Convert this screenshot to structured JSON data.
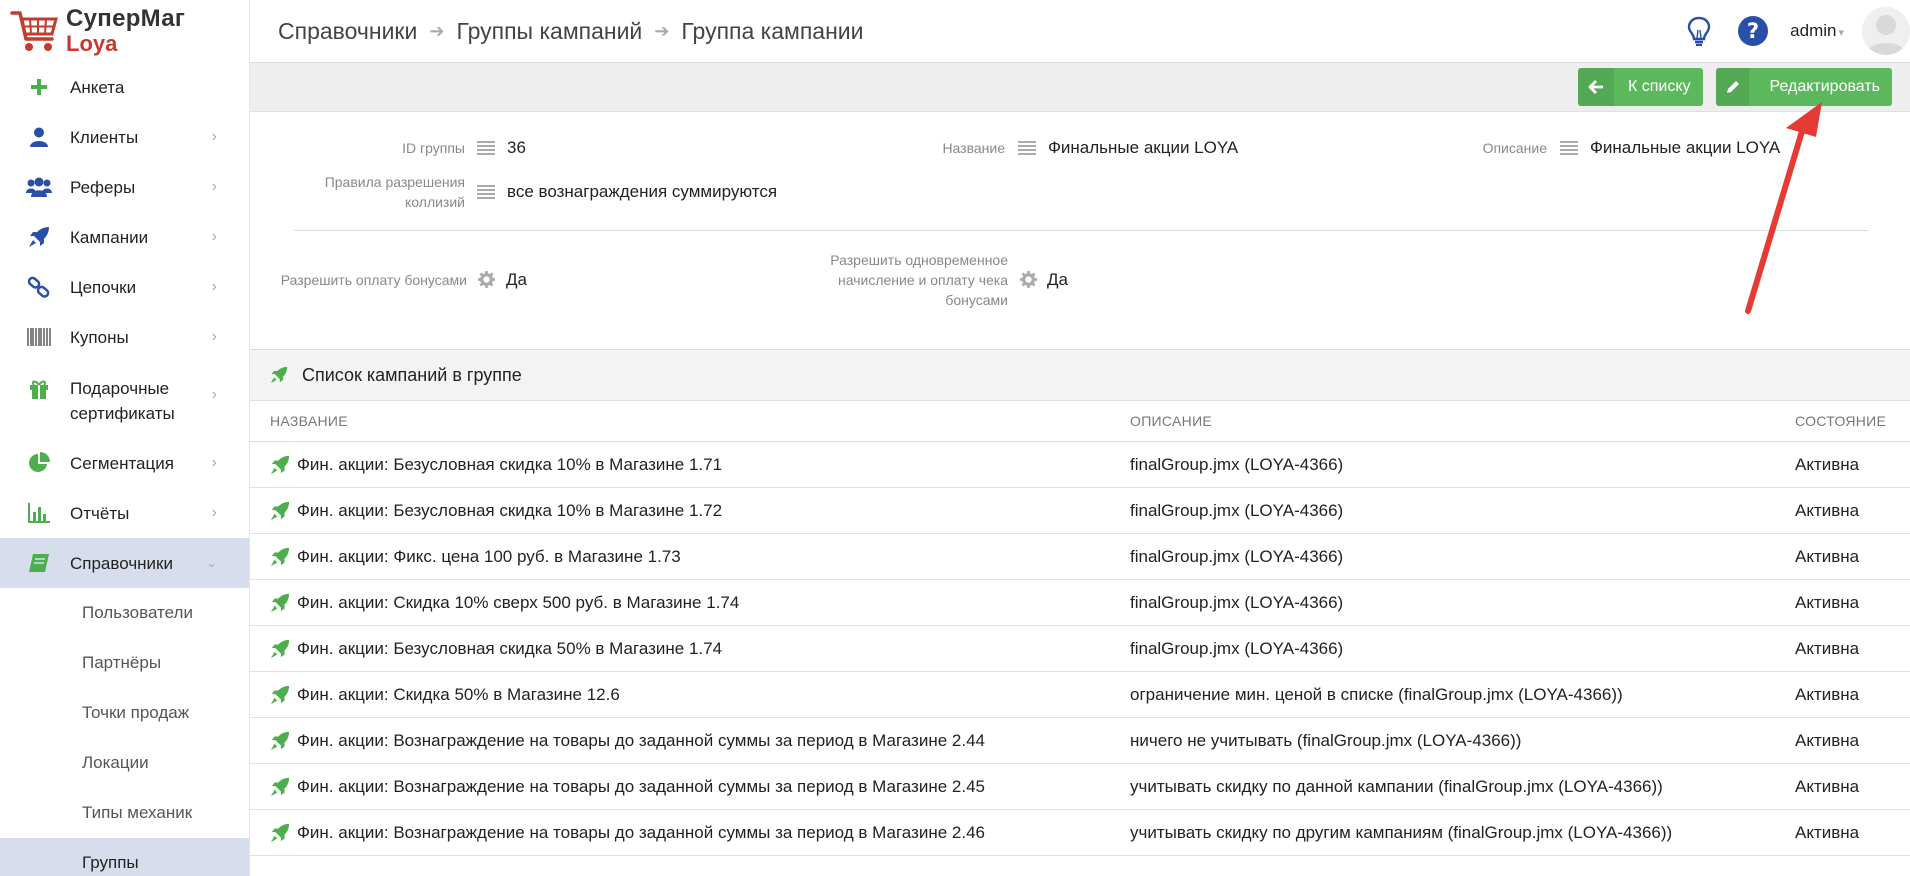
{
  "brand": {
    "line1": "СуперМаг",
    "line2": "Loya"
  },
  "sidebar": {
    "items": [
      {
        "label": "Анкета",
        "icon": "plus-icon"
      },
      {
        "label": "Клиенты",
        "icon": "user-icon"
      },
      {
        "label": "Реферы",
        "icon": "users-icon"
      },
      {
        "label": "Кампании",
        "icon": "rocket-icon"
      },
      {
        "label": "Цепочки",
        "icon": "link-icon"
      },
      {
        "label": "Купоны",
        "icon": "barcode-icon"
      },
      {
        "label": "Подарочные сертификаты",
        "icon": "gift-icon"
      },
      {
        "label": "Сегментация",
        "icon": "pie-chart-icon"
      },
      {
        "label": "Отчёты",
        "icon": "bar-chart-icon"
      },
      {
        "label": "Справочники",
        "icon": "book-icon"
      }
    ],
    "subitems": [
      "Пользователи",
      "Партнёры",
      "Точки продаж",
      "Локации",
      "Типы механик",
      "Группы"
    ]
  },
  "breadcrumb": [
    "Справочники",
    "Группы кампаний",
    "Группа кампании"
  ],
  "header": {
    "user": "admin"
  },
  "toolbar": {
    "back_label": "К списку",
    "edit_label": "Редактировать"
  },
  "details": {
    "id_label": "ID группы",
    "id_value": "36",
    "name_label": "Название",
    "name_value": "Финальные акции LOYA",
    "desc_label": "Описание",
    "desc_value": "Финальные акции LOYA",
    "rules_label_1": "Правила разрешения",
    "rules_label_2": "коллизий",
    "rules_value": "все вознаграждения суммируются",
    "bonus_label": "Разрешить оплату бонусами",
    "bonus_value": "Да",
    "simul_label_1": "Разрешить одновременное",
    "simul_label_2": "начисление и оплату чека",
    "simul_label_3": "бонусами",
    "simul_value": "Да"
  },
  "campaigns": {
    "title": "Список кампаний в группе",
    "columns": {
      "name": "НАЗВАНИЕ",
      "desc": "ОПИСАНИЕ",
      "state": "СОСТОЯНИЕ"
    },
    "rows": [
      {
        "name": "Фин. акции: Безусловная скидка 10% в Магазине 1.71",
        "desc": "finalGroup.jmx (LOYA-4366)",
        "state": "Активна"
      },
      {
        "name": "Фин. акции: Безусловная скидка 10% в Магазине 1.72",
        "desc": "finalGroup.jmx (LOYA-4366)",
        "state": "Активна"
      },
      {
        "name": "Фин. акции: Фикс. цена 100 руб. в Магазине 1.73",
        "desc": "finalGroup.jmx (LOYA-4366)",
        "state": "Активна"
      },
      {
        "name": "Фин. акции: Скидка 10% сверх 500 руб. в Магазине 1.74",
        "desc": "finalGroup.jmx (LOYA-4366)",
        "state": "Активна"
      },
      {
        "name": "Фин. акции: Безусловная скидка 50% в Магазине 1.74",
        "desc": "finalGroup.jmx (LOYA-4366)",
        "state": "Активна"
      },
      {
        "name": "Фин. акции: Скидка 50% в Магазине 12.6",
        "desc": "ограничение мин. ценой в списке (finalGroup.jmx (LOYA-4366))",
        "state": "Активна"
      },
      {
        "name": "Фин. акции: Вознаграждение на товары до заданной суммы за период в Магазине 2.44",
        "desc": "ничего не учитывать (finalGroup.jmx (LOYA-4366))",
        "state": "Активна"
      },
      {
        "name": "Фин. акции: Вознаграждение на товары до заданной суммы за период в Магазине 2.45",
        "desc": "учитывать скидку по данной кампании (finalGroup.jmx (LOYA-4366))",
        "state": "Активна"
      },
      {
        "name": "Фин. акции: Вознаграждение на товары до заданной суммы за период в Магазине 2.46",
        "desc": "учитывать скидку по другим кампаниям (finalGroup.jmx (LOYA-4366))",
        "state": "Активна"
      }
    ]
  },
  "colors": {
    "green": "#5cb85c",
    "accent_blue": "#2a4fa8",
    "active_bg": "#d8dded",
    "brand_red": "#c63a2f",
    "arrow_red": "#e53b35"
  }
}
